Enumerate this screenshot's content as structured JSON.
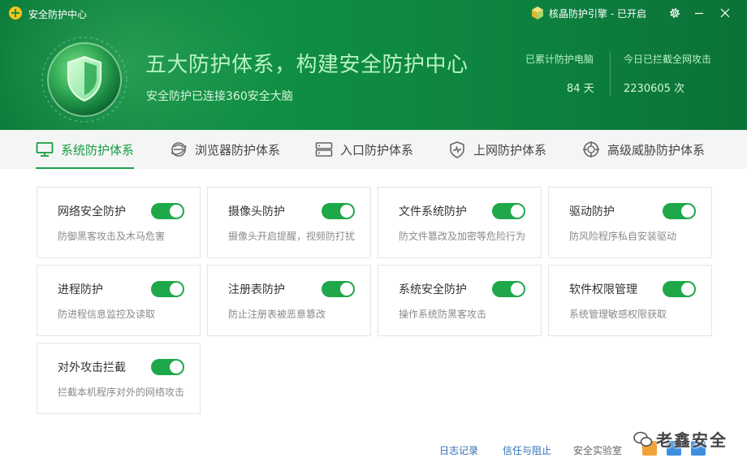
{
  "app": {
    "title": "安全防护中心",
    "engine_status": "核晶防护引擎 - 已开启"
  },
  "hero": {
    "title": "五大防护体系，构建安全防护中心",
    "subtitle": "安全防护已连接360安全大脑",
    "stats": [
      {
        "label": "已累计防护电脑",
        "value": "84 天"
      },
      {
        "label": "今日已拦截全网攻击",
        "value": "2230605 次"
      }
    ]
  },
  "tabs": [
    {
      "label": "系统防护体系",
      "icon": "monitor-icon",
      "active": true
    },
    {
      "label": "浏览器防护体系",
      "icon": "browser-icon",
      "active": false
    },
    {
      "label": "入口防护体系",
      "icon": "server-icon",
      "active": false
    },
    {
      "label": "上网防护体系",
      "icon": "shield-pulse-icon",
      "active": false
    },
    {
      "label": "高级威胁防护体系",
      "icon": "target-icon",
      "active": false
    }
  ],
  "protections": [
    {
      "title": "网络安全防护",
      "desc": "防御黑客攻击及木马危害",
      "enabled": true
    },
    {
      "title": "摄像头防护",
      "desc": "摄像头开启提醒，视频防打扰",
      "enabled": true
    },
    {
      "title": "文件系统防护",
      "desc": "防文件篡改及加密等危险行为",
      "enabled": true
    },
    {
      "title": "驱动防护",
      "desc": "防风险程序私自安装驱动",
      "enabled": true
    },
    {
      "title": "进程防护",
      "desc": "防进程信息监控及读取",
      "enabled": true
    },
    {
      "title": "注册表防护",
      "desc": "防止注册表被恶意篡改",
      "enabled": true
    },
    {
      "title": "系统安全防护",
      "desc": "操作系统防黑客攻击",
      "enabled": true
    },
    {
      "title": "软件权限管理",
      "desc": "系统管理敏感权限获取",
      "enabled": true
    },
    {
      "title": "对外攻击拦截",
      "desc": "拦截本机程序对外的网络攻击",
      "enabled": true
    }
  ],
  "footer": {
    "log": "日志记录",
    "trust": "信任与阻止",
    "lab": "安全实验室",
    "watermark": "老鑫安全"
  },
  "colors": {
    "header_green": "#0f8f45",
    "accent_green": "#1ea84a",
    "link_blue": "#2f6fb3"
  }
}
